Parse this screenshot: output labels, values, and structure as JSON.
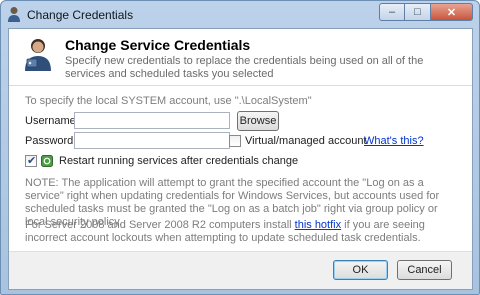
{
  "window": {
    "title": "Change Credentials",
    "caption": {
      "minimize": "–",
      "maximize": "□",
      "close": "✕"
    }
  },
  "header": {
    "title": "Change Service Credentials",
    "description": "Specify new credentials to replace the credentials being used on all of the services and scheduled tasks you selected"
  },
  "form": {
    "hint": "To specify the local SYSTEM account, use \".\\LocalSystem\"",
    "username_label": "Username:",
    "username_value": "",
    "browse_label": "Browse",
    "password_label": "Password:",
    "password_value": "",
    "virtual_label": "Virtual/managed account",
    "virtual_checked": false,
    "whats_this": "What's this?",
    "restart_label": "Restart running services after credentials change",
    "restart_checked": true
  },
  "notes": {
    "note": "NOTE: The application will attempt to grant the specified account the \"Log on as a service\" right when updating credentials for Windows Services, but accounts used for scheduled tasks must be granted the \"Log on as a batch job\" right via group policy or local security policy.",
    "server_prefix": "For Server 2008 and Server 2008 R2 computers install ",
    "server_link": "this hotfix",
    "server_suffix": " if you are seeing incorrect account lockouts when attempting to update scheduled task credentials."
  },
  "footer": {
    "ok_label": "OK",
    "cancel_label": "Cancel"
  }
}
